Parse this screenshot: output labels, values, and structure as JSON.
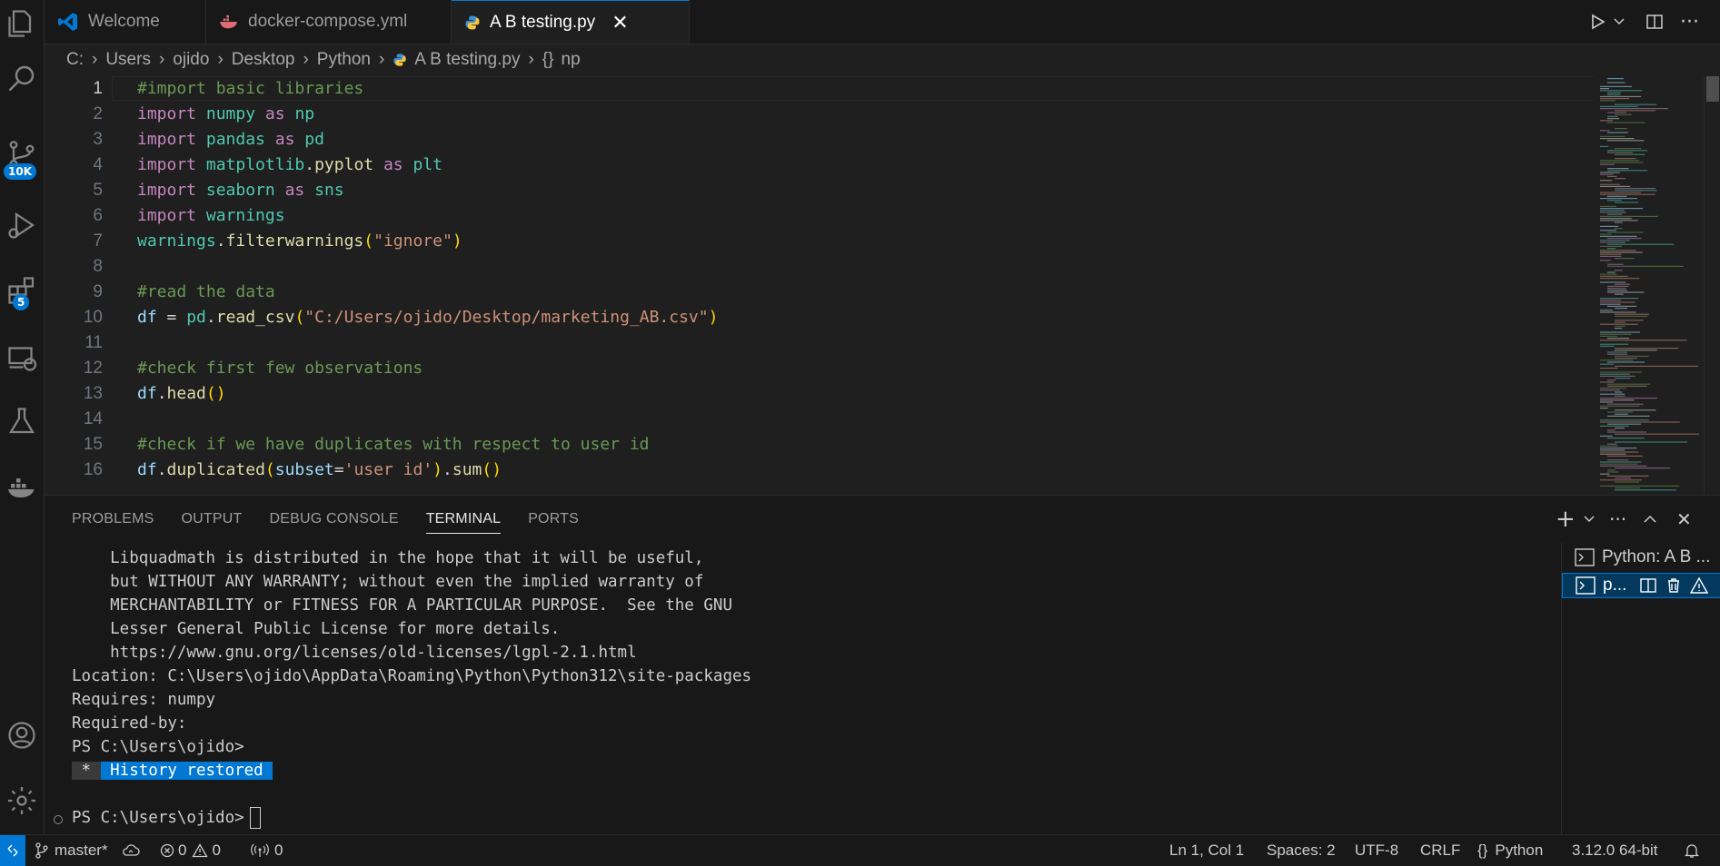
{
  "activity_bar": {
    "source_control_badge": "10K",
    "extensions_badge": "5"
  },
  "tabs": [
    {
      "label": "Welcome"
    },
    {
      "label": "docker-compose.yml"
    },
    {
      "label": "A B testing.py"
    }
  ],
  "breadcrumb": [
    "C:",
    "Users",
    "ojido",
    "Desktop",
    "Python",
    "A B testing.py",
    "np"
  ],
  "editor": {
    "current_line": 1,
    "lines": [
      {
        "n": "1",
        "text": "#import basic libraries"
      },
      {
        "n": "2",
        "text": "import numpy as np"
      },
      {
        "n": "3",
        "text": "import pandas as pd"
      },
      {
        "n": "4",
        "text": "import matplotlib.pyplot as plt"
      },
      {
        "n": "5",
        "text": "import seaborn as sns"
      },
      {
        "n": "6",
        "text": "import warnings"
      },
      {
        "n": "7",
        "text": "warnings.filterwarnings(\"ignore\")"
      },
      {
        "n": "8",
        "text": ""
      },
      {
        "n": "9",
        "text": "#read the data"
      },
      {
        "n": "10",
        "text": "df = pd.read_csv(\"C:/Users/ojido/Desktop/marketing_AB.csv\")"
      },
      {
        "n": "11",
        "text": ""
      },
      {
        "n": "12",
        "text": "#check first few observations"
      },
      {
        "n": "13",
        "text": "df.head()"
      },
      {
        "n": "14",
        "text": ""
      },
      {
        "n": "15",
        "text": "#check if we have duplicates with respect to user id"
      },
      {
        "n": "16",
        "text": "df.duplicated(subset='user id').sum()"
      }
    ]
  },
  "panel": {
    "tabs": [
      "PROBLEMS",
      "OUTPUT",
      "DEBUG CONSOLE",
      "TERMINAL",
      "PORTS"
    ],
    "active_tab": "TERMINAL",
    "terminal_lines": [
      "    Libquadmath is distributed in the hope that it will be useful,",
      "    but WITHOUT ANY WARRANTY; without even the implied warranty of",
      "    MERCHANTABILITY or FITNESS FOR A PARTICULAR PURPOSE.  See the GNU",
      "    Lesser General Public License for more details.",
      "    https://www.gnu.org/licenses/old-licenses/lgpl-2.1.html",
      "Location: C:\\Users\\ojido\\AppData\\Roaming\\Python\\Python312\\site-packages",
      "Requires: numpy",
      "Required-by:",
      "PS C:\\Users\\ojido>"
    ],
    "history_star": " * ",
    "history_label": " History restored ",
    "prompt": "PS C:\\Users\\ojido>",
    "terminals": [
      {
        "label": "Python: A B ..."
      },
      {
        "label": "p..."
      }
    ]
  },
  "status_bar": {
    "branch": "master*",
    "errors": "0",
    "warnings": "0",
    "ports": "0",
    "position": "Ln 1, Col 1",
    "spaces": "Spaces: 2",
    "encoding": "UTF-8",
    "eol": "CRLF",
    "language": "Python",
    "interpreter": "3.12.0 64-bit"
  },
  "colors": {
    "accent": "#0078d4",
    "background": "#1f1f1f",
    "keyword": "#c586c0",
    "module": "#4ec9b0",
    "comment": "#6a9955",
    "string": "#ce9178"
  }
}
